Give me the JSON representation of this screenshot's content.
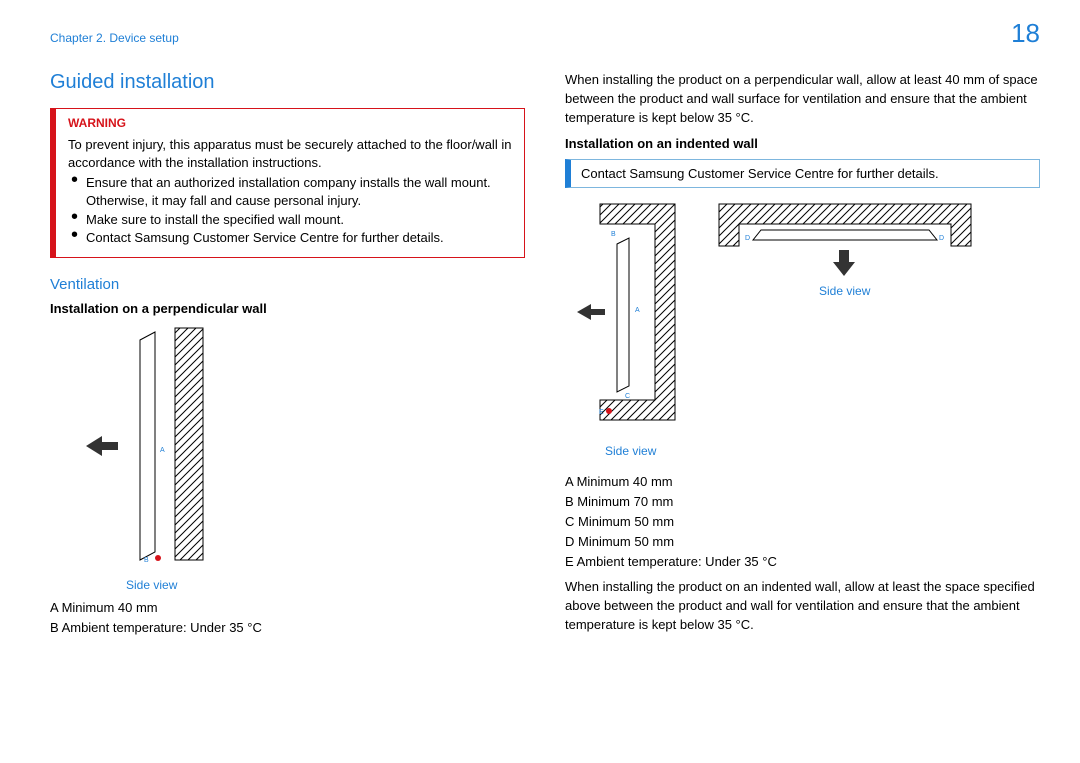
{
  "header": {
    "chapter": "Chapter 2.  Device setup",
    "page": "18"
  },
  "section_title": "Guided installation",
  "warning": {
    "title": "Warning",
    "intro": "To prevent injury, this apparatus must be securely attached to the floor/wall in accordance with the installation instructions.",
    "bullets": [
      "Ensure that an authorized installation company installs the wall mount. Otherwise, it may fall and cause personal injury.",
      "Make sure to install the specified wall mount.",
      "Contact Samsung Customer Service Centre for further details."
    ]
  },
  "ventilation": {
    "heading": "Ventilation",
    "perp": {
      "title": "Installation on a perpendicular wall",
      "side_view": "Side view",
      "legend_a": "A  Minimum 40 mm",
      "legend_b": "B  Ambient temperature: Under 35 °C",
      "label_a": "A",
      "label_b": "B"
    }
  },
  "right": {
    "intro": "When installing the product on a perpendicular wall, allow at least 40 mm of space between the product and wall surface for ventilation and ensure that the ambient temperature is kept below 35 °C.",
    "indented": {
      "title": "Installation on an indented wall",
      "info": "Contact Samsung Customer Service Centre for further details.",
      "side_view": "Side view",
      "legend_a": "A  Minimum 40 mm",
      "legend_b": "B  Minimum 70 mm",
      "legend_c": "C  Minimum 50 mm",
      "legend_d": "D  Minimum 50 mm",
      "legend_e": "E  Ambient temperature: Under 35 °C",
      "outro": "When installing the product on an indented wall, allow at least the space specified above between the product and wall for ventilation and ensure that the ambient temperature is kept below 35 °C.",
      "label_a": "A",
      "label_b": "B",
      "label_c": "C",
      "label_d": "D",
      "label_e": "E"
    }
  }
}
